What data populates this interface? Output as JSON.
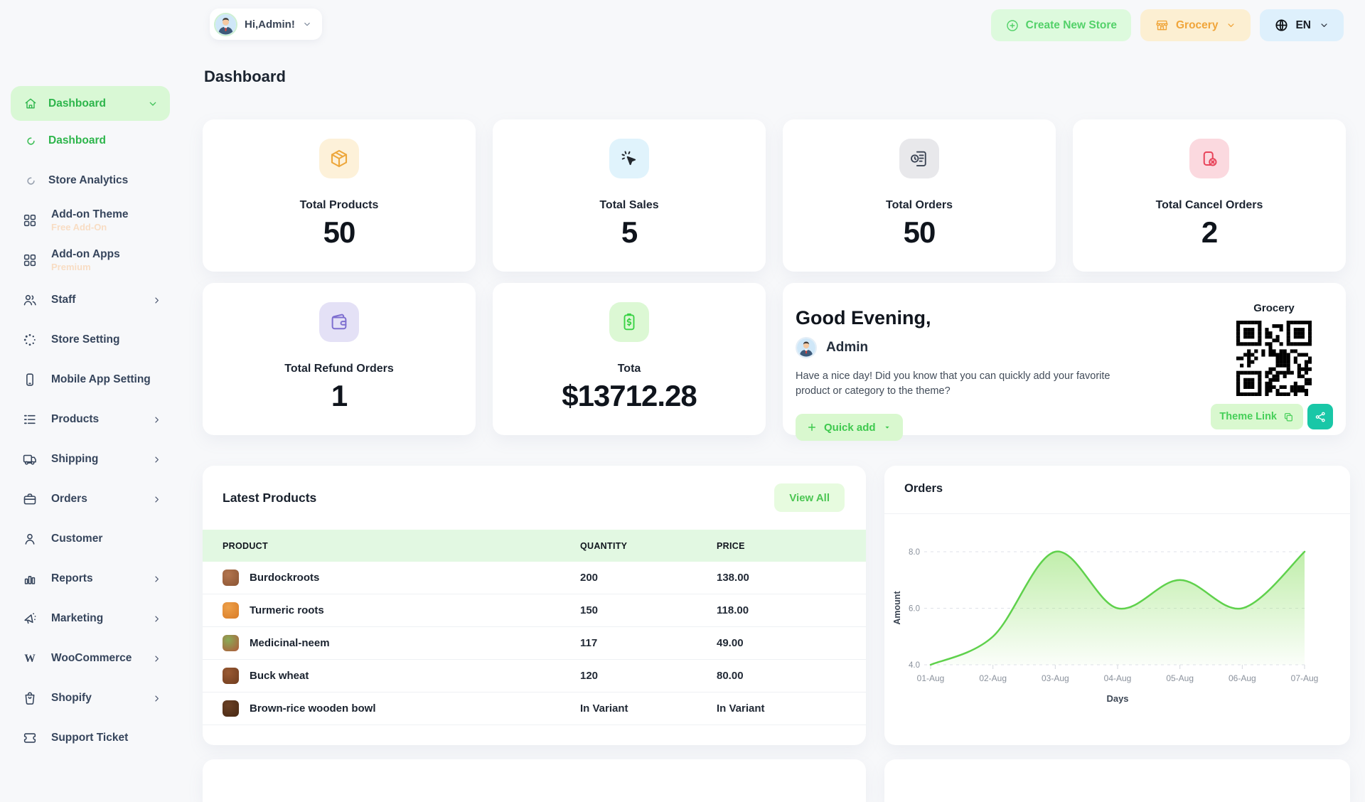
{
  "header": {
    "user_greeting": "Hi,Admin!",
    "create_store": "Create New Store",
    "store_name": "Grocery",
    "language": "EN"
  },
  "page_title": "Dashboard",
  "sidebar": {
    "group": {
      "label": "Dashboard"
    },
    "items": [
      {
        "label": "Dashboard",
        "icon": "loader-icon",
        "type": "sub",
        "active": true
      },
      {
        "label": "Store Analytics",
        "icon": "loader-icon",
        "type": "sub"
      },
      {
        "label": "Add-on Theme",
        "icon": "grid-icon",
        "sub_label": "Free Add-On"
      },
      {
        "label": "Add-on Apps",
        "icon": "grid-icon",
        "sub_label": "Premium"
      },
      {
        "label": "Staff",
        "icon": "users-icon",
        "chevron": true
      },
      {
        "label": "Store Setting",
        "icon": "dots-circle-icon"
      },
      {
        "label": "Mobile App Setting",
        "icon": "mobile-icon"
      },
      {
        "label": "Products",
        "icon": "list-icon",
        "chevron": true
      },
      {
        "label": "Shipping",
        "icon": "truck-icon",
        "chevron": true
      },
      {
        "label": "Orders",
        "icon": "briefcase-icon",
        "chevron": true
      },
      {
        "label": "Customer",
        "icon": "user-icon"
      },
      {
        "label": "Reports",
        "icon": "bar-chart-icon",
        "chevron": true
      },
      {
        "label": "Marketing",
        "icon": "megaphone-icon",
        "chevron": true
      },
      {
        "label": "WooCommerce",
        "icon": "woocommerce-icon",
        "chevron": true
      },
      {
        "label": "Shopify",
        "icon": "shopify-icon",
        "chevron": true
      },
      {
        "label": "Support Ticket",
        "icon": "ticket-icon"
      }
    ]
  },
  "stats": [
    {
      "label": "Total Products",
      "value": "50",
      "icon": "package-icon",
      "bg": "#fdf1d9",
      "color": "#eda73c"
    },
    {
      "label": "Total Sales",
      "value": "5",
      "icon": "cursor-click-icon",
      "bg": "#e0f3fc",
      "color": "#23282e"
    },
    {
      "label": "Total Orders",
      "value": "50",
      "icon": "order-history-icon",
      "bg": "#e8e8eb",
      "color": "#3a4354"
    },
    {
      "label": "Total Cancel Orders",
      "value": "2",
      "icon": "cancel-order-icon",
      "bg": "#fbd9df",
      "color": "#e8445a"
    },
    {
      "label": "Total Refund Orders",
      "value": "1",
      "icon": "wallet-icon",
      "bg": "#e4e1f6",
      "color": "#7e6fd0"
    },
    {
      "label": "Tota",
      "value": "$13712.28",
      "icon": "invoice-dollar-icon",
      "bg": "#dcf8d4",
      "color": "#38d244"
    }
  ],
  "greeting_card": {
    "title": "Good Evening,",
    "user_name": "Admin",
    "message": "Have a nice day! Did you know that you can quickly add your favorite product or category to the theme?",
    "quick_add": "Quick add",
    "qr_label": "Grocery",
    "theme_link": "Theme Link"
  },
  "latest_products": {
    "title": "Latest Products",
    "view_all": "View All",
    "columns": [
      "PRODUCT",
      "QUANTITY",
      "PRICE"
    ],
    "rows": [
      {
        "product": "Burdockroots",
        "quantity": "200",
        "price": "138.00",
        "thumb": "#b3754e",
        "thumb2": "#8a5433"
      },
      {
        "product": "Turmeric roots",
        "quantity": "150",
        "price": "118.00",
        "thumb": "#eda04a",
        "thumb2": "#d97b26"
      },
      {
        "product": "Medicinal-neem",
        "quantity": "117",
        "price": "49.00",
        "thumb": "#8aab57",
        "thumb2": "#b05a3a"
      },
      {
        "product": "Buck wheat",
        "quantity": "120",
        "price": "80.00",
        "thumb": "#9a5a33",
        "thumb2": "#6f3c1e"
      },
      {
        "product": "Brown-rice wooden bowl",
        "quantity": "In Variant",
        "price": "In Variant",
        "thumb": "#6b4125",
        "thumb2": "#472813"
      }
    ]
  },
  "orders_card": {
    "title": "Orders"
  },
  "chart_data": {
    "type": "area",
    "title": "Orders",
    "x": [
      "01-Aug",
      "02-Aug",
      "03-Aug",
      "04-Aug",
      "05-Aug",
      "06-Aug",
      "07-Aug"
    ],
    "values": [
      4,
      5,
      8,
      6,
      7,
      6,
      8
    ],
    "xlabel": "Days",
    "ylabel": "Amount",
    "ylim": [
      4,
      8
    ],
    "yticks": [
      4,
      6,
      8
    ],
    "ytick_labels": [
      "4.0",
      "6.0",
      "8.0"
    ],
    "grid": "dashed horizontal",
    "legend": "none",
    "line_color": "#5fd14c",
    "fill_top": "rgba(141,224,102,0.55)",
    "fill_bottom": "rgba(141,224,102,0.04)"
  },
  "colors": {
    "accent_green": "#2db54b",
    "light_green": "#d9f8d5",
    "accent_orange": "#f0a53a",
    "teal_share": "#19c7a7",
    "table_header_bg": "#e2f8e2",
    "page_bg": "#f7f8fa"
  }
}
